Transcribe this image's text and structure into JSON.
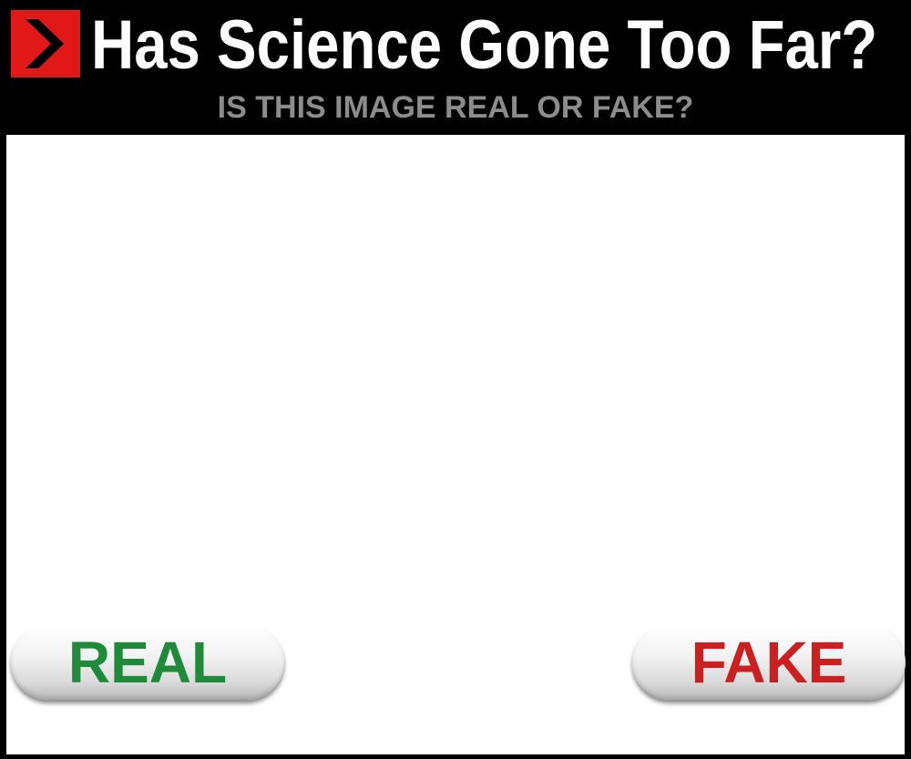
{
  "header": {
    "logo_icon": "red-play-arrow-icon",
    "title": "Has Science Gone Too Far?",
    "subtitle": "IS THIS IMAGE REAL OR FAKE?"
  },
  "buttons": {
    "real_label": "REAL",
    "fake_label": "FAKE"
  },
  "colors": {
    "background": "#000000",
    "logo_red": "#e01818",
    "subtitle_gray": "#8c8c8c",
    "real_green": "#1e8a3a",
    "fake_red": "#cc1f1f"
  }
}
